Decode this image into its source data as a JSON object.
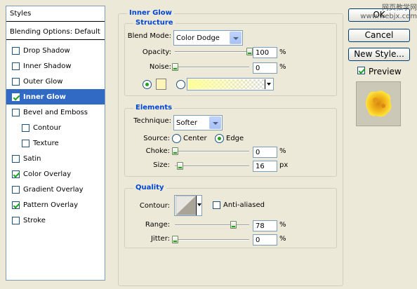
{
  "style_list": {
    "header": "Styles",
    "blending": "Blending Options: Default",
    "items": [
      {
        "label": "Drop Shadow",
        "checked": false
      },
      {
        "label": "Inner Shadow",
        "checked": false
      },
      {
        "label": "Outer Glow",
        "checked": false
      },
      {
        "label": "Inner Glow",
        "checked": true,
        "selected": true
      },
      {
        "label": "Bevel and Emboss",
        "checked": false
      },
      {
        "label": "Contour",
        "checked": false
      },
      {
        "label": "Texture",
        "checked": false
      },
      {
        "label": "Satin",
        "checked": false
      },
      {
        "label": "Color Overlay",
        "checked": true
      },
      {
        "label": "Gradient Overlay",
        "checked": false
      },
      {
        "label": "Pattern Overlay",
        "checked": true
      },
      {
        "label": "Stroke",
        "checked": false
      }
    ]
  },
  "panel": {
    "title": "Inner Glow",
    "structure": {
      "legend": "Structure",
      "blend_mode_label": "Blend Mode:",
      "blend_mode_value": "Color Dodge",
      "opacity_label": "Opacity:",
      "opacity_value": "100",
      "opacity_unit": "%",
      "opacity_level": 1.0,
      "noise_label": "Noise:",
      "noise_value": "0",
      "noise_unit": "%",
      "noise_level": 0.0,
      "color_swatch": "#fff4b8",
      "gradient_from": "#ffff99"
    },
    "elements": {
      "legend": "Elements",
      "technique_label": "Technique:",
      "technique_value": "Softer",
      "source_label": "Source:",
      "source_center": "Center",
      "source_edge": "Edge",
      "choke_label": "Choke:",
      "choke_value": "0",
      "choke_unit": "%",
      "choke_level": 0.0,
      "size_label": "Size:",
      "size_value": "16",
      "size_unit": "px",
      "size_level": 0.065
    },
    "quality": {
      "legend": "Quality",
      "contour_label": "Contour:",
      "anti_aliased": "Anti-aliased",
      "range_label": "Range:",
      "range_value": "78",
      "range_unit": "%",
      "range_level": 0.78,
      "jitter_label": "Jitter:",
      "jitter_value": "0",
      "jitter_unit": "%",
      "jitter_level": 0.0
    }
  },
  "buttons": {
    "ok": "OK",
    "cancel": "Cancel",
    "new_style": "New Style...",
    "preview": "Preview"
  },
  "watermark": "网页教学网 www.webjx.com",
  "colors": {
    "accent": "#316ac5",
    "legend": "#0046d5",
    "check": "#21a121"
  }
}
